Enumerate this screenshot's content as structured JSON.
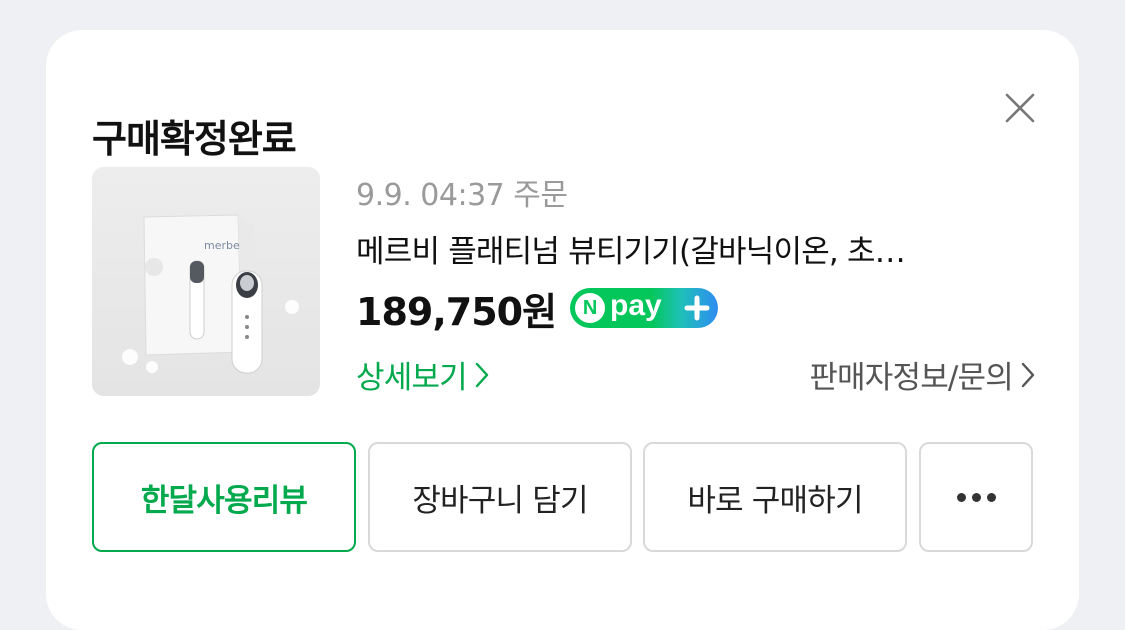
{
  "card": {
    "title": "구매확정완료",
    "close_icon": "close-icon"
  },
  "order": {
    "time": "9.9. 04:37 주문",
    "product_name": "메르비 플래티넘 뷰티기기(갈바닉이온, 초…",
    "price": "189,750원",
    "image_brand": "merbe"
  },
  "npay": {
    "n_letter": "N",
    "text": "pay",
    "icon": "plus-icon"
  },
  "links": {
    "detail": "상세보기",
    "seller": "판매자정보/문의"
  },
  "buttons": {
    "review": "한달사용리뷰",
    "cart": "장바구니 담기",
    "buy": "바로 구매하기",
    "more_icon": "more-dots-icon"
  },
  "colors": {
    "accent_green": "#03a94d",
    "npay_green": "#03c75a",
    "npay_blue": "#2f8cf2",
    "background": "#eef0f3"
  }
}
